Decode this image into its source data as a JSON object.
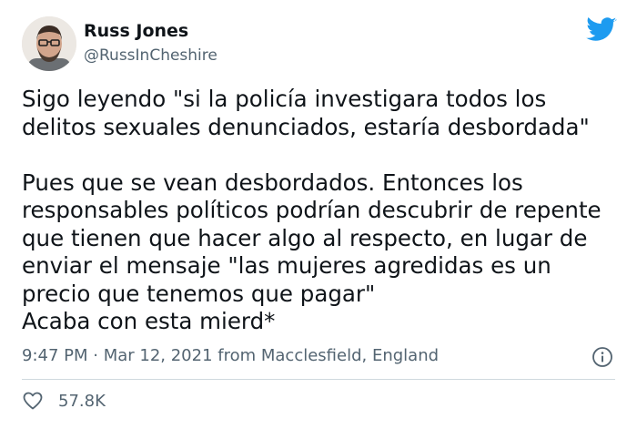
{
  "author": {
    "name": "Russ Jones",
    "handle": "@RussInCheshire"
  },
  "tweet": {
    "text_lines": [
      "Sigo leyendo \"si la policía investigara todos los",
      "delitos sexuales denunciados, estaría desbordada\"",
      "",
      "Pues que se vean desbordados. Entonces los",
      "responsables políticos podrían descubrir de repente",
      "que tienen que hacer algo al respecto, en lugar de",
      "enviar el mensaje \"las mujeres agredidas es un",
      "precio que tenemos que pagar\"",
      "Acaba con esta mierd*"
    ],
    "meta": "9:47 PM · Mar 12, 2021 from Macclesfield, England",
    "likes": "57.8K"
  },
  "icons": {
    "brand": "twitter-bird-icon",
    "info": "info-icon",
    "like": "heart-icon"
  },
  "colors": {
    "brand": "#1d9bf0",
    "text": "#0f1419",
    "secondary": "#536471"
  }
}
